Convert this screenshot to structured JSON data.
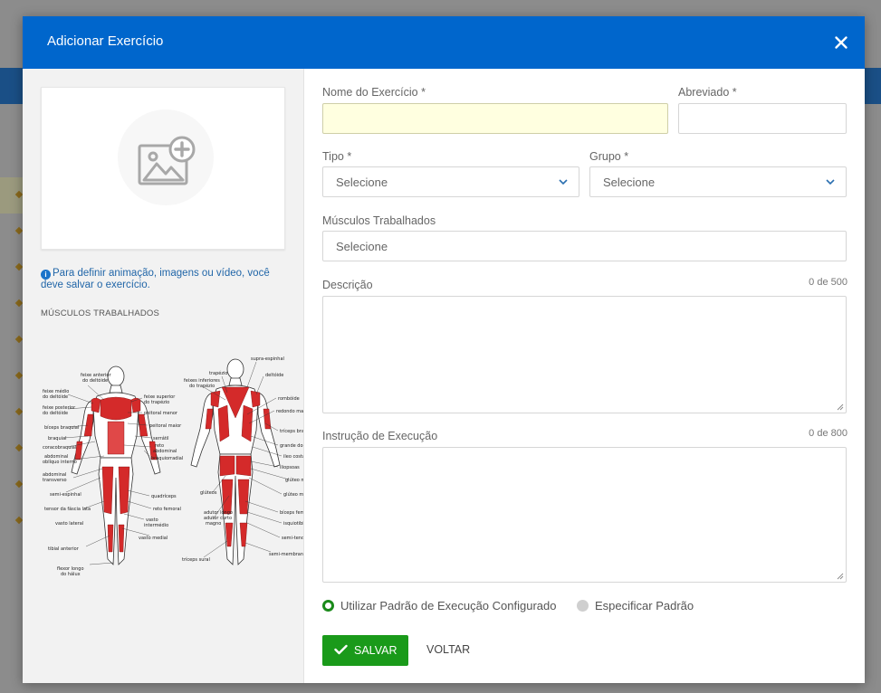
{
  "modal": {
    "title": "Adicionar Exercício",
    "close_icon": "close-icon"
  },
  "left": {
    "image_placeholder_icon": "add-image-icon",
    "info_text": "Para definir animação, imagens ou vídeo, você deve salvar o exercício.",
    "info_icon": "info-icon",
    "muscles_heading": "MÚSCULOS TRABALHADOS",
    "anatomy_labels": {
      "front": [
        "feixe anterior do deltóide",
        "feixe médio do deltóide",
        "feixe posterior do deltóide",
        "feixe superior do trapézio",
        "peitoral menor",
        "peitoral maior",
        "bíceps braquial",
        "braquial",
        "serrátil",
        "coracobraquial",
        "reto abdominal",
        "braquiorradial",
        "abdominal oblíquo interno",
        "abdominal transverso",
        "semi-espinhal",
        "tensor da fáscia lata",
        "quadríceps",
        "reto femoral",
        "vasto lateral",
        "vasto intermédio",
        "vasto medial",
        "tibial anterior",
        "flexor longo do hálux"
      ],
      "back": [
        "supra-espinhal",
        "trapézio",
        "deltóide",
        "feixes inferiores do trapézio",
        "rombóide",
        "redondo maior",
        "tríceps braquial",
        "grande dorsal",
        "ileo costal",
        "iliopsoas",
        "glúteo médio",
        "glúteos",
        "glúteo máximo",
        "adutor longo",
        "adutor curto",
        "magno",
        "bíceps femural",
        "isquiotibiais",
        "semi-tendinoso",
        "tríceps sural",
        "semi-membranoso"
      ]
    }
  },
  "form": {
    "name_label": "Nome do Exercício *",
    "name_value": "",
    "abbrev_label": "Abreviado *",
    "abbrev_value": "",
    "type_label": "Tipo *",
    "type_value": "Selecione",
    "group_label": "Grupo *",
    "group_value": "Selecione",
    "muscles_label": "Músculos Trabalhados",
    "muscles_placeholder": "Selecione",
    "description_label": "Descrição",
    "description_counter": "0 de 500",
    "instruction_label": "Instrução de Execução",
    "instruction_counter": "0 de 800",
    "radio_default_label": "Utilizar Padrão de Execução Configurado",
    "radio_default_selected": true,
    "radio_custom_label": "Especificar Padrão",
    "radio_custom_selected": false,
    "save_label": "SALVAR",
    "back_label": "VOLTAR"
  },
  "colors": {
    "header": "#0066cc",
    "save": "#1a9a1a",
    "required_field_bg": "#ffffe0",
    "muscle_highlight": "#d42a2a",
    "info_text": "#2166a8"
  }
}
